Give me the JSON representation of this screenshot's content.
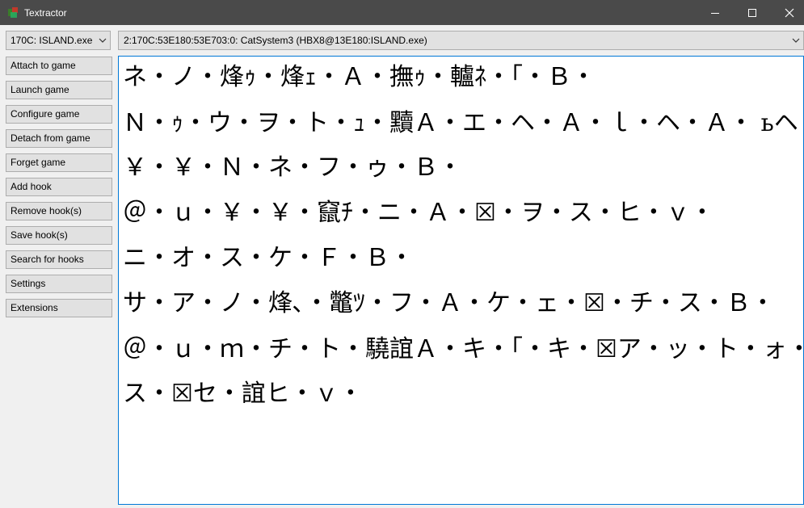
{
  "window": {
    "title": "Textractor",
    "controls": [
      "minimize",
      "maximize",
      "close"
    ]
  },
  "process_select": {
    "value": "170C: ISLAND.exe"
  },
  "hook_select": {
    "value": "2:170C:53E180:53E703:0: CatSystem3 (HBX8@13E180:ISLAND.exe)"
  },
  "sidebar": {
    "buttons": [
      "Attach to game",
      "Launch game",
      "Configure game",
      "Detach from game",
      "Forget game",
      "Add hook",
      "Remove hook(s)",
      "Save hook(s)",
      "Search for hooks",
      "Settings",
      "Extensions"
    ]
  },
  "output": {
    "lines": [
      "ネ・ノ・烽ｩ・烽ｪ・Ａ・撫ｩ・轤ﾈ・「・Ｂ・",
      "Ｎ・ｩ・ウ・ヲ・ト・ｭ・黷Ａ・エ・ヘ・Ａ・ｌ・ヘ・Ａ・ ьヘ・",
      "￥・￥・Ｎ・ネ・フ・ゥ・Ｂ・",
      "＠・ｕ・￥・￥・竄ﾁ・ニ・Ａ・☒・ヲ・ス・ヒ・ｖ・",
      "ニ・オ・ス・ケ・Ｆ・Ｂ・",
      "サ・ア・ノ・烽､・鼈ﾂ・フ・Ａ・ケ・ェ・☒・チ・ス・Ｂ・",
      "＠・ｕ・ｍ・チ・ト・驍誼Ａ・キ・「・キ・☒ア・ッ・ト・ォ・",
      "ス・☒セ・誼ヒ・ｖ・"
    ]
  },
  "colors": {
    "titlebar": "#4a4a4a",
    "window_bg": "#f0f0f0",
    "button_bg": "#e1e1e1",
    "button_border": "#adadad",
    "focus_border": "#0078d7"
  }
}
